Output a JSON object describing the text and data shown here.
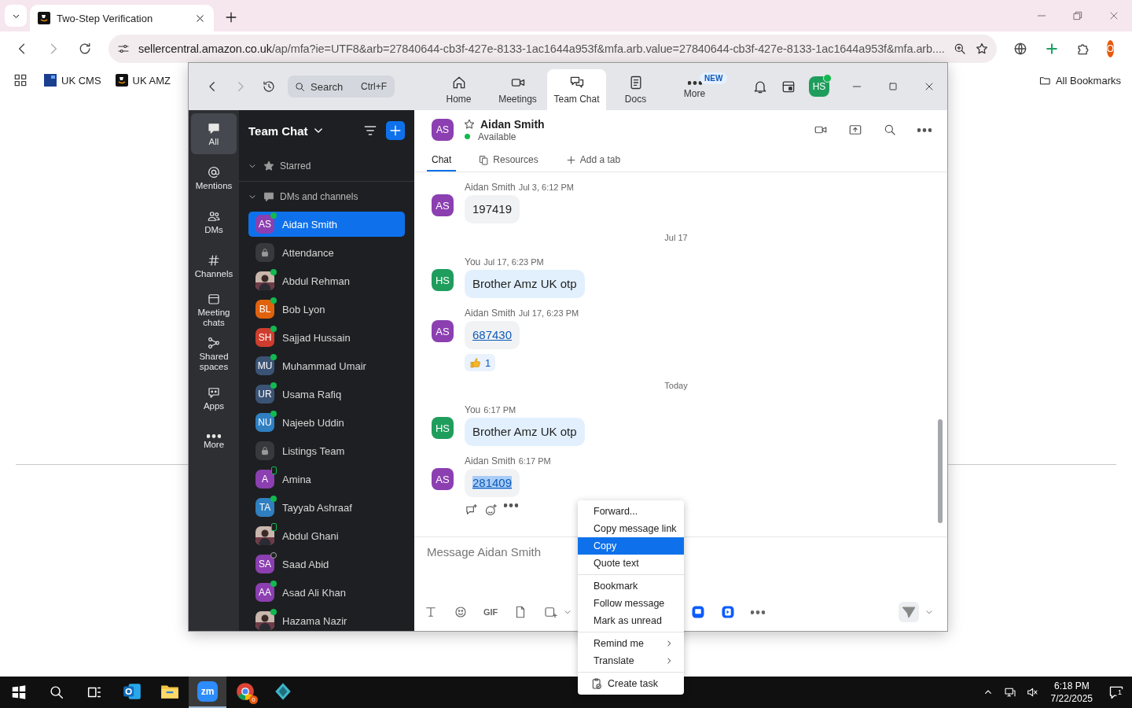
{
  "browser": {
    "tab": {
      "title": "Two-Step Verification"
    },
    "url": {
      "host": "sellercentral.amazon.co.uk",
      "path": "/ap/mfa?ie=UTF8&arb=27840644-cb3f-427e-8133-1ac1644a953f&mfa.arb.value=27840644-cb3f-427e-8133-1ac1644a953f&mfa.arb...."
    },
    "profile": "O",
    "bookmarks": [
      {
        "label": "UK CMS",
        "kind": "cms"
      },
      {
        "label": "UK AMZ",
        "kind": "amz"
      }
    ],
    "all_bookmarks": "All Bookmarks"
  },
  "zoom": {
    "search": {
      "placeholder": "Search",
      "shortcut": "Ctrl+F"
    },
    "nav": [
      {
        "label": "Home",
        "selected": false
      },
      {
        "label": "Meetings",
        "selected": false
      },
      {
        "label": "Team Chat",
        "selected": true
      },
      {
        "label": "Docs",
        "selected": false
      },
      {
        "label": "More",
        "selected": false,
        "badge": "NEW"
      }
    ],
    "user": {
      "initials": "HS",
      "online": true
    },
    "rail": [
      {
        "label": "All",
        "selected": true
      },
      {
        "label": "Mentions",
        "selected": false
      },
      {
        "label": "DMs",
        "selected": false
      },
      {
        "label": "Channels",
        "selected": false
      },
      {
        "label": "Meeting chats",
        "selected": false
      },
      {
        "label": "Shared spaces",
        "selected": false
      },
      {
        "label": "Apps",
        "selected": false
      },
      {
        "label": "More",
        "selected": false
      }
    ],
    "list": {
      "title": "Team Chat",
      "sections": [
        {
          "label": "Starred",
          "expanded": true
        },
        {
          "label": "DMs and channels",
          "expanded": true
        }
      ],
      "items": [
        {
          "name": "Aidan Smith",
          "kind": "initials",
          "initials": "AS",
          "color": "#8b3fb0",
          "online": true,
          "mobile": false,
          "offline": false,
          "selected": true
        },
        {
          "name": "Attendance",
          "kind": "lock",
          "online": false,
          "mobile": false,
          "offline": false,
          "selected": false
        },
        {
          "name": "Abdul Rehman",
          "kind": "picture",
          "online": true,
          "mobile": false,
          "offline": false,
          "selected": false
        },
        {
          "name": "Bob Lyon",
          "kind": "initials",
          "initials": "BL",
          "color": "#e0620d",
          "online": true,
          "mobile": false,
          "offline": false,
          "selected": false
        },
        {
          "name": "Sajjad Hussain",
          "kind": "initials",
          "initials": "SH",
          "color": "#cf3d2e",
          "online": true,
          "mobile": false,
          "offline": false,
          "selected": false
        },
        {
          "name": "Muhammad Umair",
          "kind": "initials",
          "initials": "MU",
          "color": "#3b5375",
          "online": true,
          "mobile": false,
          "offline": false,
          "selected": false
        },
        {
          "name": "Usama Rafiq",
          "kind": "initials",
          "initials": "UR",
          "color": "#3b5375",
          "online": true,
          "mobile": false,
          "offline": false,
          "selected": false
        },
        {
          "name": "Najeeb Uddin",
          "kind": "initials",
          "initials": "NU",
          "color": "#2f7fc1",
          "online": true,
          "mobile": false,
          "offline": false,
          "selected": false
        },
        {
          "name": "Listings Team",
          "kind": "lock",
          "online": false,
          "mobile": false,
          "offline": false,
          "selected": false
        },
        {
          "name": "Amina",
          "kind": "initials",
          "initials": "A",
          "color": "#8b3fb0",
          "online": false,
          "mobile": true,
          "offline": false,
          "selected": false
        },
        {
          "name": "Tayyab Ashraaf",
          "kind": "initials",
          "initials": "TA",
          "color": "#2f7fc1",
          "online": true,
          "mobile": false,
          "offline": false,
          "selected": false
        },
        {
          "name": "Abdul Ghani",
          "kind": "picture",
          "online": false,
          "mobile": true,
          "offline": false,
          "selected": false
        },
        {
          "name": "Saad Abid",
          "kind": "initials",
          "initials": "SA",
          "color": "#8b3fb0",
          "online": false,
          "mobile": false,
          "offline": true,
          "selected": false
        },
        {
          "name": "Asad Ali Khan",
          "kind": "initials",
          "initials": "AA",
          "color": "#8b3fb0",
          "online": true,
          "mobile": false,
          "offline": false,
          "selected": false
        },
        {
          "name": "Hazama Nazir",
          "kind": "picture",
          "online": true,
          "mobile": false,
          "offline": false,
          "selected": false
        }
      ]
    },
    "chat": {
      "contact": {
        "initials": "AS",
        "color": "#8b3fb0",
        "name": "Aidan Smith",
        "status": "Available",
        "starred": false
      },
      "tabs": [
        {
          "label": "Chat",
          "selected": true
        },
        {
          "label": "Resources",
          "selected": false
        },
        {
          "label": "Add a tab",
          "selected": false
        }
      ],
      "messages": [
        {
          "kind": "message",
          "sender": "Aidan Smith",
          "time": "Jul 3, 6:12 PM",
          "initials": "AS",
          "color": "#8b3fb0",
          "mine": false,
          "text": "197419",
          "link": false,
          "highlighted": false,
          "hovered": false
        },
        {
          "kind": "divider",
          "label": "Jul 17"
        },
        {
          "kind": "message",
          "sender": "You",
          "time": "Jul 17, 6:23 PM",
          "initials": "HS",
          "color": "#1f9d5c",
          "mine": true,
          "text": "Brother Amz UK otp",
          "link": false,
          "highlighted": false,
          "hovered": false
        },
        {
          "kind": "message",
          "sender": "Aidan Smith",
          "time": "Jul 17, 6:23 PM",
          "initials": "AS",
          "color": "#8b3fb0",
          "mine": false,
          "text": "687430",
          "link": true,
          "highlighted": false,
          "hovered": false,
          "reaction": "1"
        },
        {
          "kind": "divider",
          "label": "Today"
        },
        {
          "kind": "message",
          "sender": "You",
          "time": "6:17 PM",
          "initials": "HS",
          "color": "#1f9d5c",
          "mine": true,
          "text": "Brother Amz UK otp",
          "link": false,
          "highlighted": false,
          "hovered": false
        },
        {
          "kind": "message",
          "sender": "Aidan Smith",
          "time": "6:17 PM",
          "initials": "AS",
          "color": "#8b3fb0",
          "mine": false,
          "text": "281409",
          "link": true,
          "highlighted": true,
          "hovered": true
        }
      ],
      "composer": {
        "placeholder": "Message Aidan Smith",
        "gif": "GIF"
      }
    }
  },
  "context_menu": {
    "groups": [
      {
        "items": [
          {
            "label": "Forward...",
            "selected": false,
            "submenu": false
          },
          {
            "label": "Copy message link",
            "selected": false,
            "submenu": false
          },
          {
            "label": "Copy",
            "selected": true,
            "submenu": false
          },
          {
            "label": "Quote text",
            "selected": false,
            "submenu": false
          }
        ]
      },
      {
        "items": [
          {
            "label": "Bookmark",
            "selected": false,
            "submenu": false
          },
          {
            "label": "Follow message",
            "selected": false,
            "submenu": false
          },
          {
            "label": "Mark as unread",
            "selected": false,
            "submenu": false
          }
        ]
      },
      {
        "items": [
          {
            "label": "Remind me",
            "selected": false,
            "submenu": true
          },
          {
            "label": "Translate",
            "selected": false,
            "submenu": true
          }
        ]
      },
      {
        "items": [
          {
            "label": "Create task",
            "selected": false,
            "submenu": false,
            "kind": "task"
          }
        ]
      }
    ]
  },
  "taskbar": {
    "apps": [
      {
        "kind": "outlook",
        "active": false
      },
      {
        "kind": "explorer",
        "active": false
      },
      {
        "kind": "zoom",
        "label": "zm",
        "active": true
      },
      {
        "kind": "chrome",
        "badge": "0",
        "active": false
      },
      {
        "kind": "diamond",
        "active": false
      }
    ],
    "time": "6:18 PM",
    "date": "7/22/2025",
    "notifications": "1"
  }
}
